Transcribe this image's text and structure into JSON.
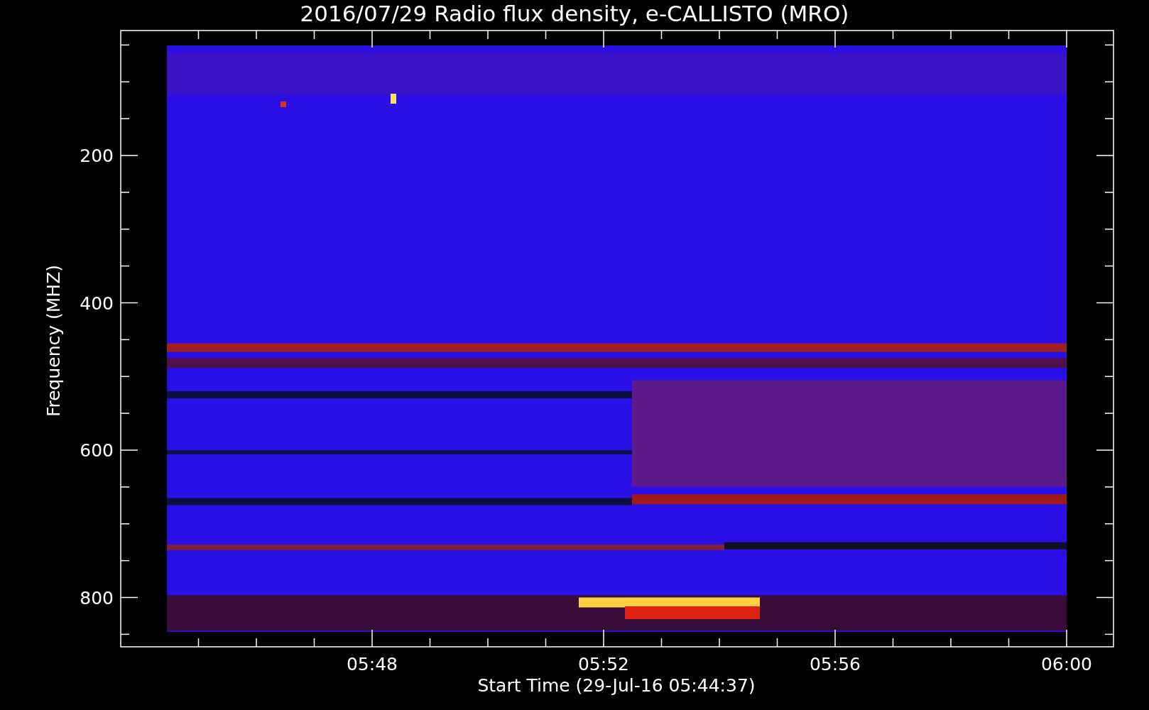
{
  "title": "2016/07/29  Radio flux density, e-CALLISTO (MRO)",
  "y_axis": {
    "label": "Frequency (MHZ)",
    "ticks": [
      "200",
      "400",
      "600",
      "800"
    ]
  },
  "x_axis": {
    "label": "Start Time (29-Jul-16 05:44:37)",
    "ticks": [
      "05:48",
      "05:52",
      "05:56",
      "06:00"
    ]
  }
}
